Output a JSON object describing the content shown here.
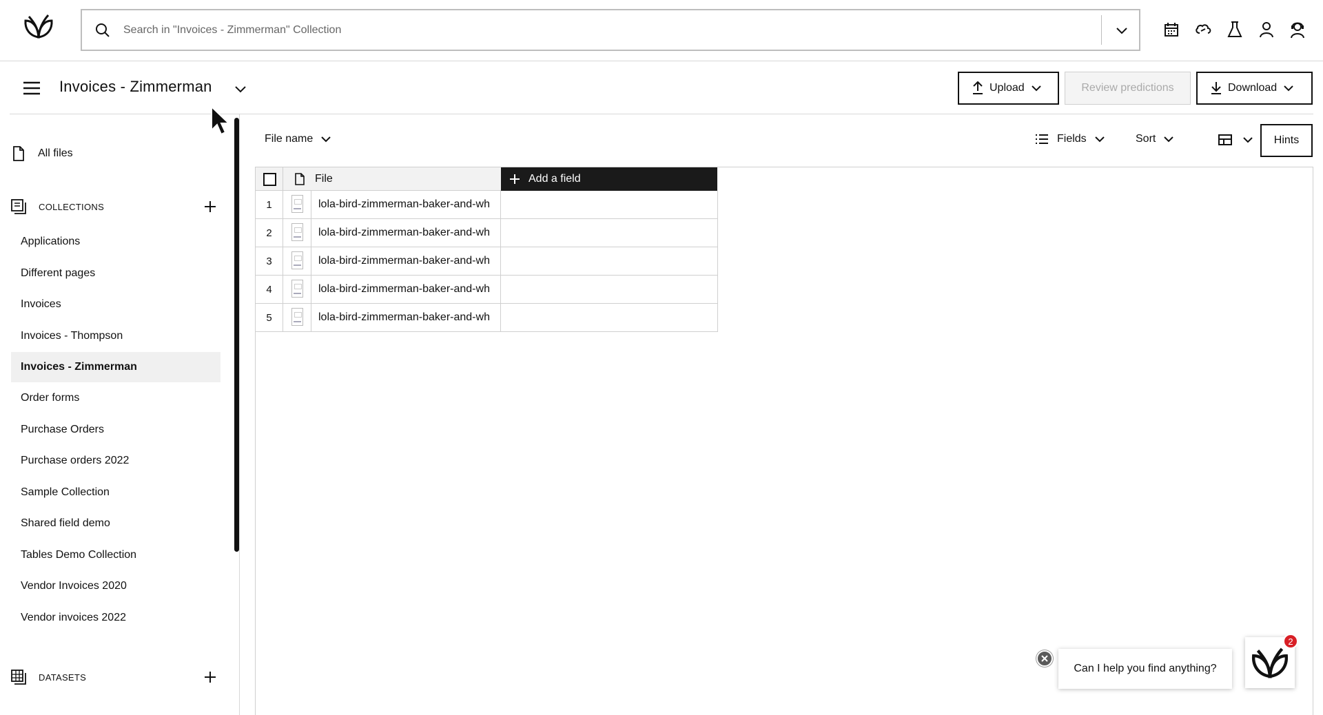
{
  "search": {
    "placeholder": "Search in \"Invoices - Zimmerman\" Collection"
  },
  "top_icons": [
    "calendar-icon",
    "link-cloud-icon",
    "flask-icon",
    "user-icon",
    "agent-icon"
  ],
  "header": {
    "title": "Invoices - Zimmerman",
    "upload_label": "Upload",
    "review_label": "Review predictions",
    "download_label": "Download"
  },
  "sidebar": {
    "all_files": "All files",
    "collections_heading": "COLLECTIONS",
    "collections": [
      "Applications",
      "Different pages",
      "Invoices",
      "Invoices - Thompson",
      "Invoices - Zimmerman",
      "Order forms",
      "Purchase Orders",
      "Purchase orders 2022",
      "Sample Collection",
      "Shared field demo",
      "Tables Demo Collection",
      "Vendor Invoices 2020",
      "Vendor invoices 2022"
    ],
    "active_collection": "Invoices - Zimmerman",
    "datasets_heading": "DATASETS"
  },
  "toolbar": {
    "file_name_label": "File name",
    "fields_label": "Fields",
    "sort_label": "Sort",
    "hints_label": "Hints"
  },
  "table": {
    "file_header": "File",
    "add_field_label": "Add a field",
    "rows": [
      {
        "num": "1",
        "file": "lola-bird-zimmerman-baker-and-wh"
      },
      {
        "num": "2",
        "file": "lola-bird-zimmerman-baker-and-wh"
      },
      {
        "num": "3",
        "file": "lola-bird-zimmerman-baker-and-wh"
      },
      {
        "num": "4",
        "file": "lola-bird-zimmerman-baker-and-wh"
      },
      {
        "num": "5",
        "file": "lola-bird-zimmerman-baker-and-wh"
      }
    ]
  },
  "chat": {
    "message": "Can I help you find anything?",
    "badge_count": "2"
  }
}
